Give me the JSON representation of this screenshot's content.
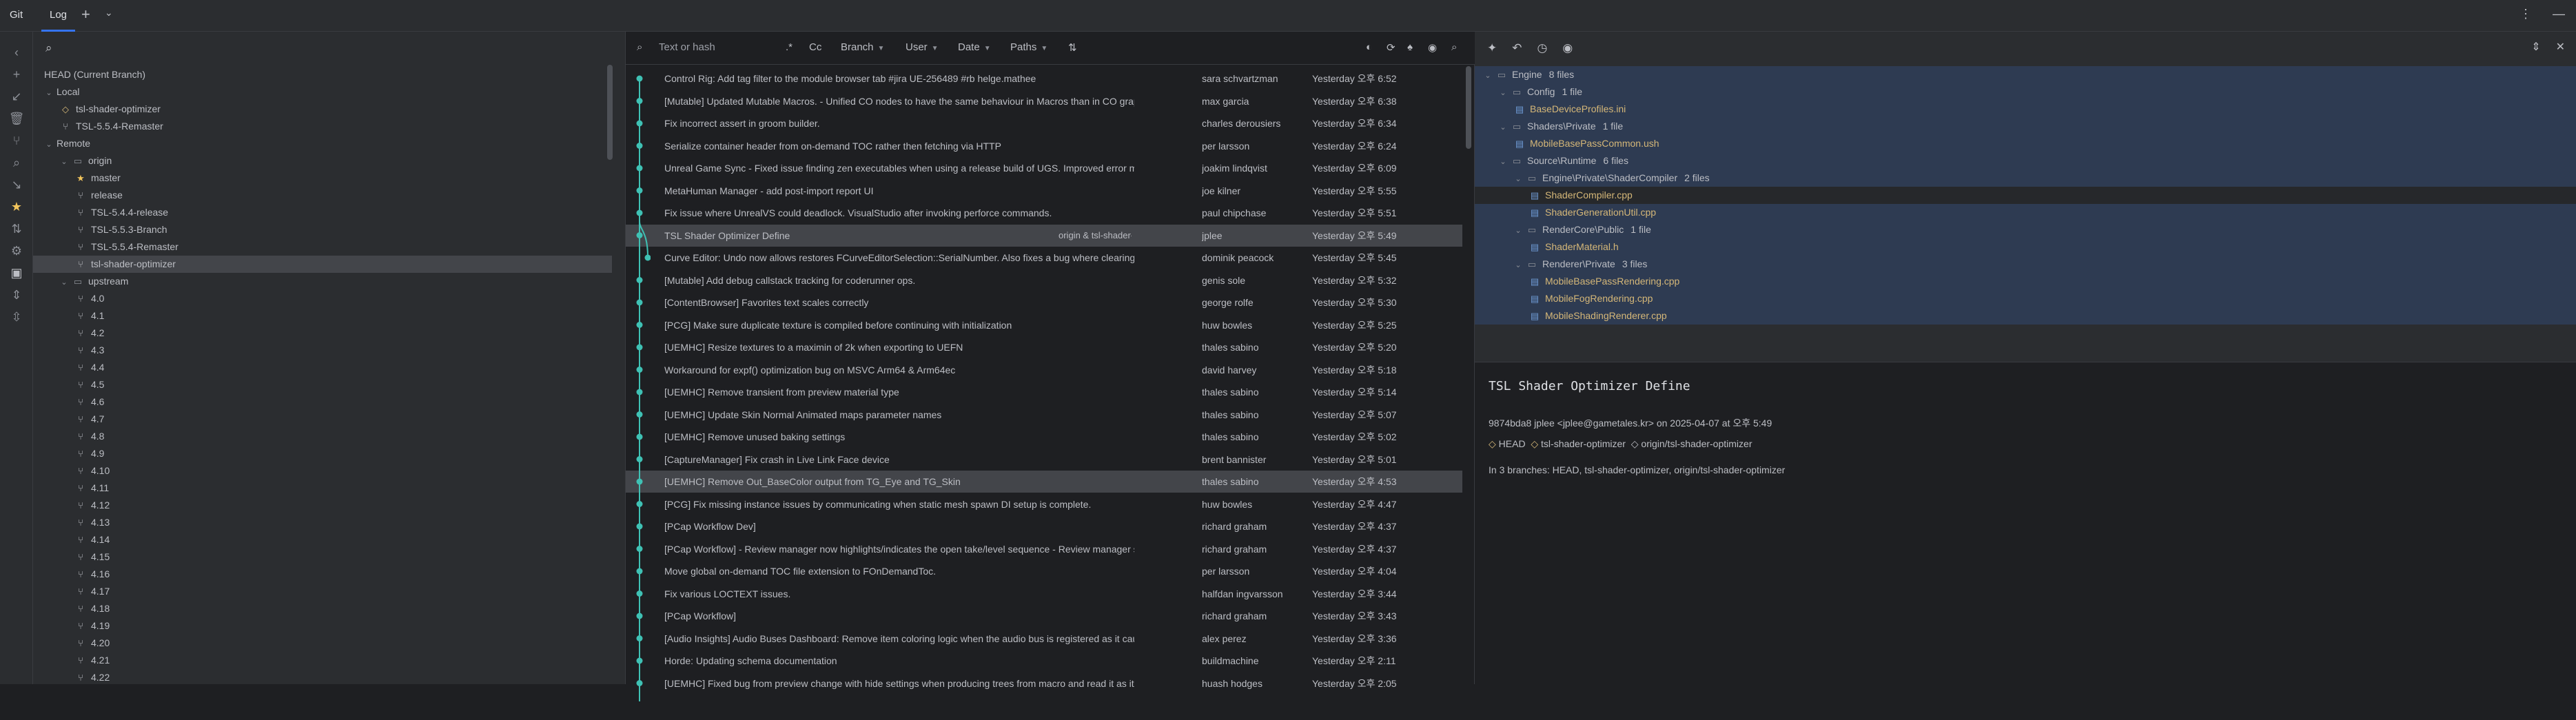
{
  "titlebar": {
    "app": "Git",
    "tab": "Log",
    "plus": "+",
    "chevron": "⌄",
    "right_icons": [
      "⋮",
      "—",
      "✕"
    ]
  },
  "branches": {
    "search_placeholder": "",
    "items": [
      {
        "level": 0,
        "kind": "plain",
        "label": "HEAD (Current Branch)"
      },
      {
        "level": 0,
        "kind": "group",
        "label": "Local"
      },
      {
        "level": 1,
        "kind": "tag",
        "label": "tsl-shader-optimizer"
      },
      {
        "level": 1,
        "kind": "branch",
        "label": "TSL-5.5.4-Remaster"
      },
      {
        "level": 0,
        "kind": "group",
        "label": "Remote"
      },
      {
        "level": 1,
        "kind": "folder",
        "label": "origin"
      },
      {
        "level": 2,
        "kind": "star",
        "label": "master"
      },
      {
        "level": 2,
        "kind": "branch",
        "label": "release"
      },
      {
        "level": 2,
        "kind": "branch",
        "label": "TSL-5.4.4-release"
      },
      {
        "level": 2,
        "kind": "branch",
        "label": "TSL-5.5.3-Branch"
      },
      {
        "level": 2,
        "kind": "branch",
        "label": "TSL-5.5.4-Remaster"
      },
      {
        "level": 2,
        "kind": "branch",
        "label": "tsl-shader-optimizer",
        "selected": true
      },
      {
        "level": 1,
        "kind": "folder",
        "label": "upstream"
      },
      {
        "level": 2,
        "kind": "branch",
        "label": "4.0"
      },
      {
        "level": 2,
        "kind": "branch",
        "label": "4.1"
      },
      {
        "level": 2,
        "kind": "branch",
        "label": "4.2"
      },
      {
        "level": 2,
        "kind": "branch",
        "label": "4.3"
      },
      {
        "level": 2,
        "kind": "branch",
        "label": "4.4"
      },
      {
        "level": 2,
        "kind": "branch",
        "label": "4.5"
      },
      {
        "level": 2,
        "kind": "branch",
        "label": "4.6"
      },
      {
        "level": 2,
        "kind": "branch",
        "label": "4.7"
      },
      {
        "level": 2,
        "kind": "branch",
        "label": "4.8"
      },
      {
        "level": 2,
        "kind": "branch",
        "label": "4.9"
      },
      {
        "level": 2,
        "kind": "branch",
        "label": "4.10"
      },
      {
        "level": 2,
        "kind": "branch",
        "label": "4.11"
      },
      {
        "level": 2,
        "kind": "branch",
        "label": "4.12"
      },
      {
        "level": 2,
        "kind": "branch",
        "label": "4.13"
      },
      {
        "level": 2,
        "kind": "branch",
        "label": "4.14"
      },
      {
        "level": 2,
        "kind": "branch",
        "label": "4.15"
      },
      {
        "level": 2,
        "kind": "branch",
        "label": "4.16"
      },
      {
        "level": 2,
        "kind": "branch",
        "label": "4.17"
      },
      {
        "level": 2,
        "kind": "branch",
        "label": "4.18"
      },
      {
        "level": 2,
        "kind": "branch",
        "label": "4.19"
      },
      {
        "level": 2,
        "kind": "branch",
        "label": "4.20"
      },
      {
        "level": 2,
        "kind": "branch",
        "label": "4.21"
      },
      {
        "level": 2,
        "kind": "branch",
        "label": "4.22"
      }
    ]
  },
  "logbar": {
    "search_placeholder": "Text or hash",
    "regex": ".*",
    "case": "Cc",
    "branch": "Branch",
    "user": "User",
    "date": "Date",
    "paths": "Paths"
  },
  "commits": [
    {
      "subject": "Control Rig: Add tag filter to the module browser tab #jira UE-256489 #rb helge.mathee",
      "author": "sara schvartzman",
      "date": "Yesterday 오후 6:52"
    },
    {
      "subject": "[Mutable] Updated Mutable Macros. - Unified CO nodes to have the same behaviour in Macros than in CO graph",
      "author": "max garcia",
      "date": "Yesterday 오후 6:38"
    },
    {
      "subject": "Fix incorrect assert in groom builder.",
      "author": "charles derousiers",
      "date": "Yesterday 오후 6:34"
    },
    {
      "subject": "Serialize container header from on-demand TOC rather then fetching via HTTP",
      "author": "per larsson",
      "date": "Yesterday 오후 6:24"
    },
    {
      "subject": "Unreal Game Sync - Fixed issue finding zen executables when using a release build of UGS. Improved error messages",
      "author": "joakim lindqvist",
      "date": "Yesterday 오후 6:09"
    },
    {
      "subject": "MetaHuman Manager - add post-import report UI",
      "author": "joe kilner",
      "date": "Yesterday 오후 5:55"
    },
    {
      "subject": "Fix issue where UnrealVS could deadlock. VisualStudio after invoking perforce commands.",
      "author": "paul chipchase",
      "date": "Yesterday 오후 5:51"
    },
    {
      "subject": "TSL Shader Optimizer Define",
      "author": "jplee",
      "date": "Yesterday 오후 5:49",
      "refs": "origin & tsl-shader-optimizer",
      "selected": true
    },
    {
      "subject": "Curve Editor: Undo now allows restores FCurveEditorSelection::SerialNumber. Also fixes a bug where clearing selection",
      "author": "dominik peacock",
      "date": "Yesterday 오후 5:45"
    },
    {
      "subject": "[Mutable] Add debug callstack tracking for coderunner ops.",
      "author": "genis sole",
      "date": "Yesterday 오후 5:32"
    },
    {
      "subject": "[ContentBrowser] Favorites text scales correctly",
      "author": "george rolfe",
      "date": "Yesterday 오후 5:30"
    },
    {
      "subject": "[PCG] Make sure duplicate texture is compiled before continuing with initialization",
      "author": "huw bowles",
      "date": "Yesterday 오후 5:25"
    },
    {
      "subject": "[UEMHC] Resize textures to a maximin of 2k when exporting to UEFN",
      "author": "thales sabino",
      "date": "Yesterday 오후 5:20"
    },
    {
      "subject": "Workaround for expf() optimization bug on MSVC Arm64 & Arm64ec",
      "author": "david harvey",
      "date": "Yesterday 오후 5:18"
    },
    {
      "subject": "[UEMHC] Remove transient from preview material type",
      "author": "thales sabino",
      "date": "Yesterday 오후 5:14"
    },
    {
      "subject": "[UEMHC] Update Skin Normal Animated maps parameter names",
      "author": "thales sabino",
      "date": "Yesterday 오후 5:07"
    },
    {
      "subject": "[UEMHC] Remove unused baking settings",
      "author": "thales sabino",
      "date": "Yesterday 오후 5:02"
    },
    {
      "subject": "[CaptureManager] Fix crash in Live Link Face device",
      "author": "brent bannister",
      "date": "Yesterday 오후 5:01"
    },
    {
      "subject": "[UEMHC] Remove Out_BaseColor output from TG_Eye and TG_Skin",
      "author": "thales sabino",
      "date": "Yesterday 오후 4:53",
      "hover": true
    },
    {
      "subject": "[PCG] Fix missing instance issues by communicating when static mesh spawn DI setup is complete.",
      "author": "huw bowles",
      "date": "Yesterday 오후 4:47"
    },
    {
      "subject": "[PCap Workflow Dev]",
      "author": "richard graham",
      "date": "Yesterday 오후 4:37"
    },
    {
      "subject": "[PCap Workflow] - Review manager now highlights/indicates the open take/level sequence - Review manager soon",
      "author": "richard graham",
      "date": "Yesterday 오후 4:37"
    },
    {
      "subject": "Move global on-demand TOC file extension to FOnDemandToc.",
      "author": "per larsson",
      "date": "Yesterday 오후 4:04"
    },
    {
      "subject": "Fix various LOCTEXT issues.",
      "author": "halfdan ingvarsson",
      "date": "Yesterday 오후 3:44"
    },
    {
      "subject": "[PCap Workflow]",
      "author": "richard graham",
      "date": "Yesterday 오후 3:43"
    },
    {
      "subject": "[Audio Insights] Audio Buses Dashboard: Remove item coloring logic when the audio bus is registered as it cause",
      "author": "alex perez",
      "date": "Yesterday 오후 3:36"
    },
    {
      "subject": "Horde: Updating schema documentation",
      "author": "buildmachine",
      "date": "Yesterday 오후 2:11"
    },
    {
      "subject": "[UEMHC] Fixed bug from preview change with hide settings when producing trees from macro and read it as it just",
      "author": "huash hodges",
      "date": "Yesterday 오후 2:05"
    }
  ],
  "changes": {
    "toolbar_icons": [
      "✦",
      "↶",
      "◷",
      "◉"
    ],
    "right_icons": [
      "⇕",
      "✕"
    ],
    "tree": [
      {
        "level": 0,
        "kind": "folder",
        "label": "Engine",
        "count": "8 files",
        "selected": true
      },
      {
        "level": 1,
        "kind": "folder",
        "label": "Config",
        "count": "1 file",
        "selected": true
      },
      {
        "level": 2,
        "kind": "file",
        "label": "BaseDeviceProfiles.ini",
        "selected": true
      },
      {
        "level": 1,
        "kind": "folder",
        "label": "Shaders\\Private",
        "count": "1 file",
        "selected": true
      },
      {
        "level": 2,
        "kind": "file",
        "label": "MobileBasePassCommon.ush",
        "selected": true
      },
      {
        "level": 1,
        "kind": "folder",
        "label": "Source\\Runtime",
        "count": "6 files",
        "selected": true
      },
      {
        "level": 2,
        "kind": "folder",
        "label": "Engine\\Private\\ShaderCompiler",
        "count": "2 files",
        "selected": true
      },
      {
        "level": 3,
        "kind": "file",
        "label": "ShaderCompiler.cpp",
        "selected": true,
        "current": true
      },
      {
        "level": 3,
        "kind": "file",
        "label": "ShaderGenerationUtil.cpp",
        "selected": true
      },
      {
        "level": 2,
        "kind": "folder",
        "label": "RenderCore\\Public",
        "count": "1 file",
        "selected": true
      },
      {
        "level": 3,
        "kind": "file",
        "label": "ShaderMaterial.h",
        "selected": true
      },
      {
        "level": 2,
        "kind": "folder",
        "label": "Renderer\\Private",
        "count": "3 files",
        "selected": true
      },
      {
        "level": 3,
        "kind": "file",
        "label": "MobileBasePassRendering.cpp",
        "selected": true
      },
      {
        "level": 3,
        "kind": "file",
        "label": "MobileFogRendering.cpp",
        "selected": true
      },
      {
        "level": 3,
        "kind": "file",
        "label": "MobileShadingRenderer.cpp",
        "selected": true
      }
    ]
  },
  "details": {
    "title": "TSL Shader Optimizer Define",
    "meta": "9874bda8 jplee <jplee@gametales.kr> on 2025-04-07 at 오후 5:49",
    "refs_head": "HEAD",
    "refs_local": "tsl-shader-optimizer",
    "refs_remote": "origin/tsl-shader-optimizer",
    "branches_line": "In 3 branches: HEAD, tsl-shader-optimizer, origin/tsl-shader-optimizer"
  },
  "colors": {
    "accent": "#3574f0",
    "graph": "#3fc1b4",
    "modified": "#d5b778",
    "selection": "#2e436e"
  }
}
